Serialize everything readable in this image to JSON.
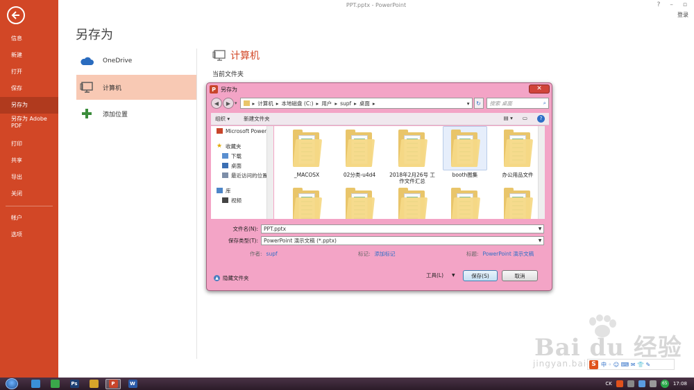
{
  "window": {
    "title": "PPT.pptx - PowerPoint",
    "controls": [
      "?",
      "–",
      "▫"
    ],
    "login": "登录"
  },
  "sidebar": {
    "items": [
      {
        "label": "信息"
      },
      {
        "label": "新建"
      },
      {
        "label": "打开"
      },
      {
        "label": "保存"
      },
      {
        "label": "另存为",
        "active": true
      },
      {
        "label": "另存为 Adobe PDF"
      },
      {
        "label": "打印"
      },
      {
        "label": "共享"
      },
      {
        "label": "导出"
      },
      {
        "label": "关闭"
      },
      {
        "label": "帐户"
      },
      {
        "label": "选项"
      }
    ]
  },
  "main": {
    "title": "另存为",
    "places": [
      {
        "label": "OneDrive",
        "icon": "cloud-icon"
      },
      {
        "label": "计算机",
        "icon": "computer-icon",
        "active": true
      },
      {
        "label": "添加位置",
        "icon": "plus-icon"
      }
    ],
    "right_heading": "计算机",
    "current_folder_label": "当前文件夹"
  },
  "dialog": {
    "title": "另存为",
    "close": "✕",
    "breadcrumb": [
      "计算机",
      "本地磁盘 (C:)",
      "用户",
      "supf",
      "桌面"
    ],
    "search_placeholder": "搜索 桌面",
    "toolbar": {
      "organize": "组织 ▾",
      "new_folder": "新建文件夹"
    },
    "tree": [
      {
        "label": "Microsoft PowerPoint",
        "indent": false
      },
      {
        "label": "收藏夹",
        "indent": false
      },
      {
        "label": "下载",
        "indent": true
      },
      {
        "label": "桌面",
        "indent": true
      },
      {
        "label": "最近访问的位置",
        "indent": true
      },
      {
        "label": "库",
        "indent": false
      },
      {
        "label": "视频",
        "indent": true
      }
    ],
    "files": [
      {
        "name": "_MACOSX"
      },
      {
        "name": "02分类-u4d4"
      },
      {
        "name": "2018年2月26号 工作文件汇总"
      },
      {
        "name": "booth图集",
        "selected": true
      },
      {
        "name": "办公用品文件"
      },
      {
        "name": ""
      },
      {
        "name": ""
      },
      {
        "name": ""
      },
      {
        "name": ""
      },
      {
        "name": ""
      }
    ],
    "filename_label": "文件名(N):",
    "filename_value": "PPT.pptx",
    "type_label": "保存类型(T):",
    "type_value": "PowerPoint 演示文稿 (*.pptx)",
    "author_label": "作者:",
    "author_value": "supf",
    "tags_label": "标记:",
    "tags_value": "添加标记",
    "title_label": "标题:",
    "title_value": "PowerPoint 演示文稿",
    "hide_folders": "隐藏文件夹",
    "tools": "工具(L)",
    "save": "保存(S)",
    "cancel": "取消"
  },
  "watermark": {
    "brand": "Bai du 经验",
    "url": "jingyan.baidu.com"
  },
  "taskbar": {
    "apps": [
      {
        "label": "",
        "icon": "pinwheel-icon",
        "color": "#3a8fd8"
      },
      {
        "label": "",
        "icon": "wechat-icon",
        "color": "#3aa84a"
      },
      {
        "label": "Ps",
        "icon": "photoshop-icon",
        "color": "#1c3f73"
      },
      {
        "label": "",
        "icon": "chrome-icon",
        "color": "#d8a52a"
      },
      {
        "label": "P",
        "icon": "powerpoint-icon",
        "color": "#c8452a",
        "active": true
      },
      {
        "label": "W",
        "icon": "word-icon",
        "color": "#2b5aa8"
      }
    ],
    "tray_ime": "CK",
    "tray_badge": "65",
    "clock": "17:08"
  },
  "colors": {
    "accent": "#d24726",
    "dialog": "#f3a4c6",
    "link": "#2d6ec7"
  }
}
